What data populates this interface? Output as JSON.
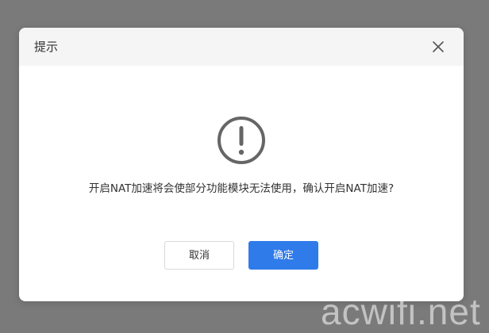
{
  "dialog": {
    "title": "提示",
    "message": "开启NAT加速将会使部分功能模块无法使用，确认开启NAT加速?",
    "cancel_label": "取消",
    "ok_label": "确定",
    "icons": {
      "close": "close-icon",
      "warning": "exclamation-circle-icon"
    }
  },
  "watermark": "acwifi.net",
  "colors": {
    "overlay": "#7a7a7a",
    "header_bg": "#f5f5f5",
    "primary": "#2f7bea",
    "icon_gray": "#666666"
  }
}
